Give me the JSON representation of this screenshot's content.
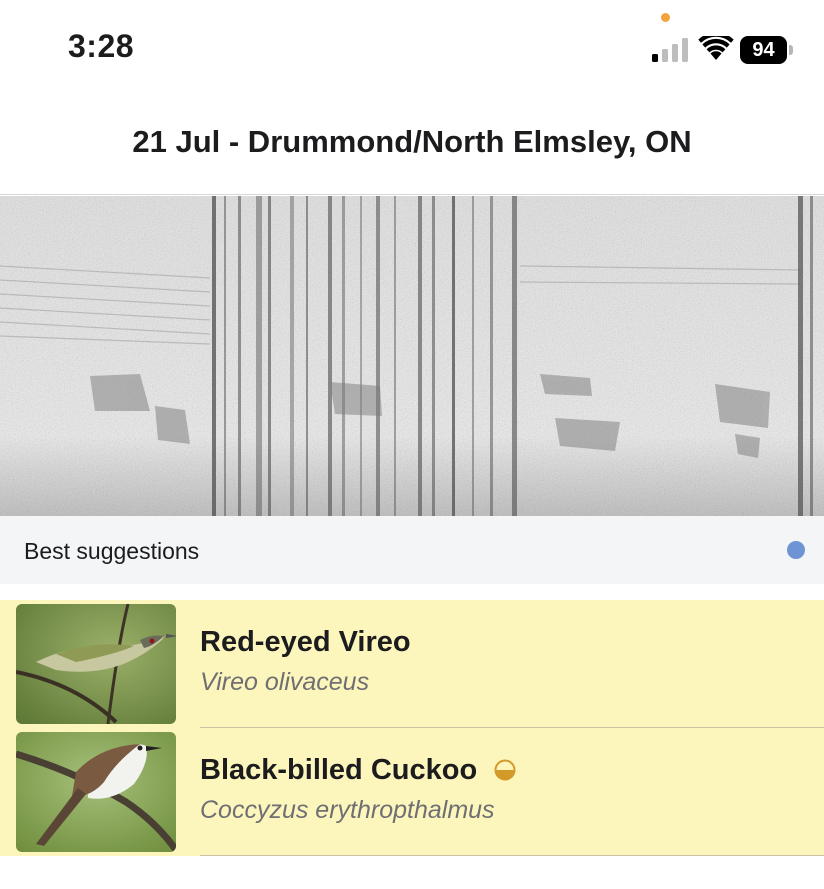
{
  "status_bar": {
    "time": "3:28",
    "battery_level": "94",
    "icons": [
      "mic-indicator-dot",
      "cellular-signal-icon",
      "wifi-icon",
      "battery-icon"
    ],
    "colors": {
      "mic_indicator": "#f2a33a"
    }
  },
  "header": {
    "title": "21 Jul - Drummond/North Elmsley, ON"
  },
  "spectrogram": {
    "icon": "spectrogram-image"
  },
  "suggestions": {
    "label": "Best suggestions",
    "indicator_color": "#6e94d6"
  },
  "results": [
    {
      "common_name": "Red-eyed Vireo",
      "scientific_name": "Vireo olivaceus",
      "thumbnail": "red-eyed-vireo-photo"
    },
    {
      "common_name": "Black-billed Cuckoo",
      "scientific_name": "Coccyzus erythropthalmus",
      "thumbnail": "black-billed-cuckoo-photo",
      "badge_icon": "half-circle-icon"
    }
  ],
  "colors": {
    "results_background": "#fcf6bd",
    "suggest_bar_background": "#f4f5f6",
    "half_icon": "#d39a2a"
  }
}
